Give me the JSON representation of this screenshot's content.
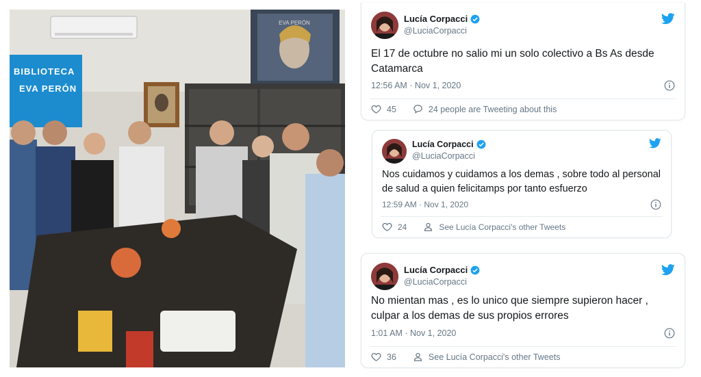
{
  "photo": {
    "sign_line1": "BIBLIOTECA",
    "sign_line2": "EVA PERÓN",
    "portrait_label": "EVA PERÓN"
  },
  "tweets": [
    {
      "name": "Lucía Corpacci",
      "handle": "@LuciaCorpacci",
      "text": "El 17 de octubre no salio mi un solo colectivo a Bs As desde Catamarca",
      "time": "12:56 AM · Nov 1, 2020",
      "likes": "45",
      "secondary": "24 people are Tweeting about this",
      "secondary_icon": "comment-icon"
    },
    {
      "name": "Lucía Corpacci",
      "handle": "@LuciaCorpacci",
      "text": "Nos cuidamos  y cuidamos a los demas , sobre todo al personal de salud a quien felicitamps por tanto esfuerzo",
      "time": "12:59 AM · Nov 1, 2020",
      "likes": "24",
      "secondary": "See Lucía Corpacci's other Tweets",
      "secondary_icon": "person-icon"
    },
    {
      "name": "Lucía Corpacci",
      "handle": "@LuciaCorpacci",
      "text": "No mientan mas , es lo unico que siempre supieron hacer , culpar a los demas de sus propios errores",
      "time": "1:01 AM · Nov 1, 2020",
      "likes": "36",
      "secondary": "See Lucía Corpacci's other Tweets",
      "secondary_icon": "person-icon"
    }
  ],
  "colors": {
    "twitter_blue": "#1da1f2",
    "text_primary": "#14171a",
    "text_secondary": "#657786"
  }
}
